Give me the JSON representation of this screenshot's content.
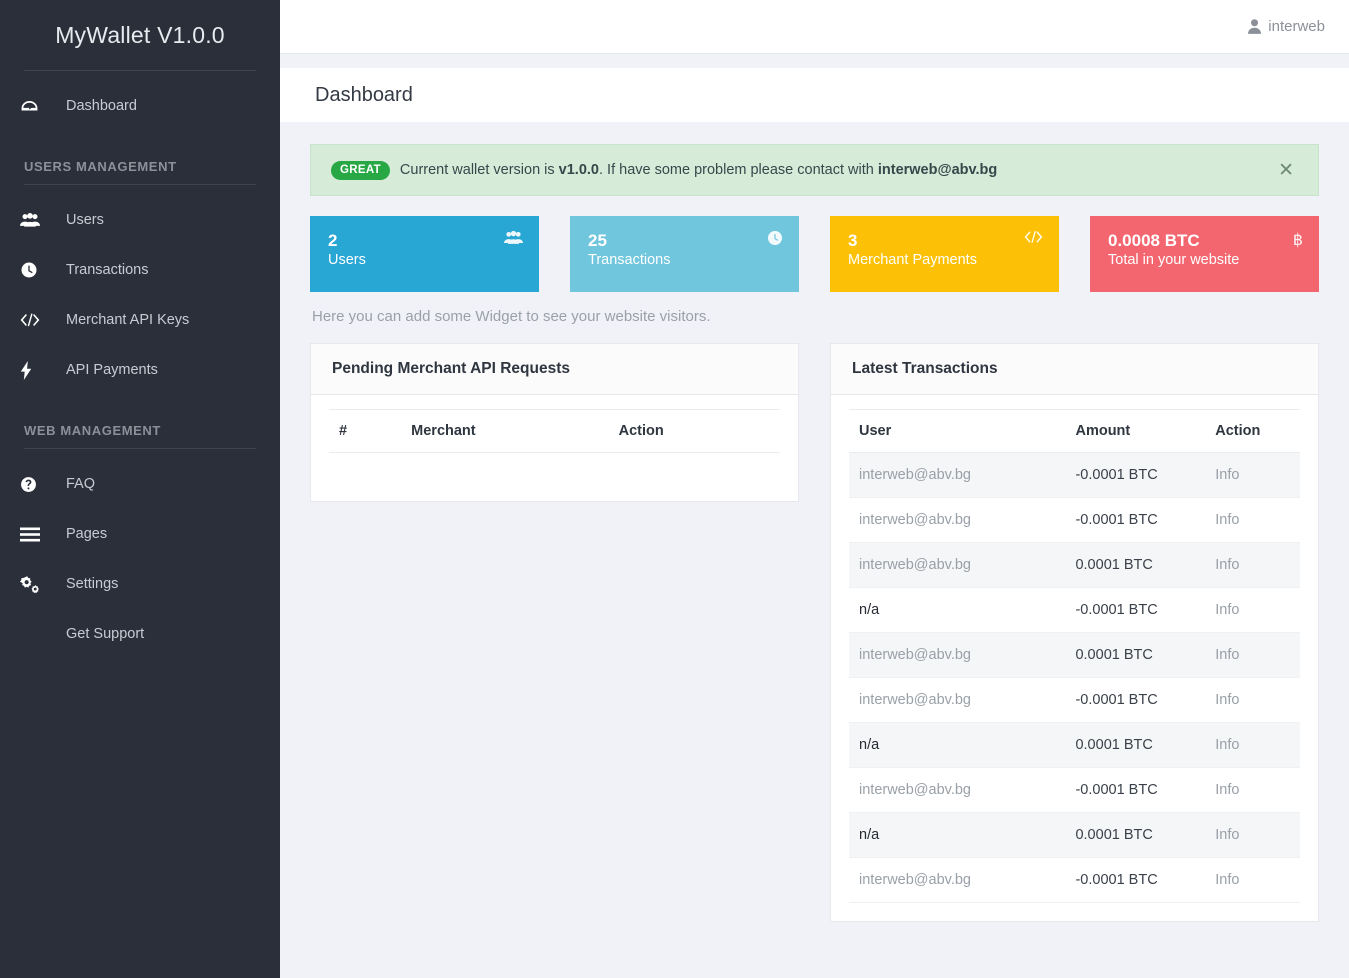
{
  "sidebar": {
    "brand": "MyWallet V1.0.0",
    "primary": [
      {
        "label": "Dashboard",
        "icon": "dashboard-gauge-icon"
      }
    ],
    "sections": [
      {
        "title": "USERS MANAGEMENT",
        "items": [
          {
            "label": "Users",
            "icon": "users-group-icon"
          },
          {
            "label": "Transactions",
            "icon": "clock-circle-icon"
          },
          {
            "label": "Merchant API Keys",
            "icon": "code-brackets-icon"
          },
          {
            "label": "API Payments",
            "icon": "lightning-bolt-icon"
          }
        ]
      },
      {
        "title": "WEB MANAGEMENT",
        "items": [
          {
            "label": "FAQ",
            "icon": "question-circle-icon"
          },
          {
            "label": "Pages",
            "icon": "hamburger-bars-icon"
          },
          {
            "label": "Settings",
            "icon": "gears-icon"
          },
          {
            "label": "Get Support",
            "icon": ""
          }
        ]
      }
    ]
  },
  "topbar": {
    "user": "interweb",
    "user_icon": "user-silhouette-icon"
  },
  "page": {
    "title": "Dashboard"
  },
  "alert": {
    "badge": "GREAT",
    "text_before": "Current wallet version is ",
    "version": "v1.0.0",
    "text_middle": ". If have some problem please contact with ",
    "contact": "interweb@abv.bg",
    "close_icon": "close-x-icon",
    "bg_color": "#d6ecd9",
    "badge_color": "#27a844"
  },
  "cards": [
    {
      "value": "2",
      "label": "Users",
      "icon": "users-group-icon",
      "color": "#28a6d4"
    },
    {
      "value": "25",
      "label": "Transactions",
      "icon": "clock-circle-icon",
      "color": "#6fc6dd"
    },
    {
      "value": "3",
      "label": "Merchant Payments",
      "icon": "code-brackets-icon",
      "color": "#fcc006"
    },
    {
      "value": "0.0008 BTC",
      "label": "Total in your website",
      "icon": "bitcoin-icon",
      "color": "#f4666f"
    }
  ],
  "widget_note": "Here you can add some Widget to see your website visitors.",
  "pending_panel": {
    "title": "Pending Merchant API Requests",
    "columns": [
      "#",
      "Merchant",
      "Action"
    ],
    "rows": []
  },
  "transactions_panel": {
    "title": "Latest Transactions",
    "columns": [
      "User",
      "Amount",
      "Action"
    ],
    "rows": [
      {
        "user": "interweb@abv.bg",
        "user_type": "link",
        "amount": "-0.0001 BTC",
        "action": "Info"
      },
      {
        "user": "interweb@abv.bg",
        "user_type": "link",
        "amount": "-0.0001 BTC",
        "action": "Info"
      },
      {
        "user": "interweb@abv.bg",
        "user_type": "link",
        "amount": "0.0001 BTC",
        "action": "Info"
      },
      {
        "user": "n/a",
        "user_type": "plain",
        "amount": "-0.0001 BTC",
        "action": "Info"
      },
      {
        "user": "interweb@abv.bg",
        "user_type": "link",
        "amount": "0.0001 BTC",
        "action": "Info"
      },
      {
        "user": "interweb@abv.bg",
        "user_type": "link",
        "amount": "-0.0001 BTC",
        "action": "Info"
      },
      {
        "user": "n/a",
        "user_type": "plain",
        "amount": "0.0001 BTC",
        "action": "Info"
      },
      {
        "user": "interweb@abv.bg",
        "user_type": "link",
        "amount": "-0.0001 BTC",
        "action": "Info"
      },
      {
        "user": "n/a",
        "user_type": "plain",
        "amount": "0.0001 BTC",
        "action": "Info"
      },
      {
        "user": "interweb@abv.bg",
        "user_type": "link",
        "amount": "-0.0001 BTC",
        "action": "Info"
      }
    ]
  }
}
